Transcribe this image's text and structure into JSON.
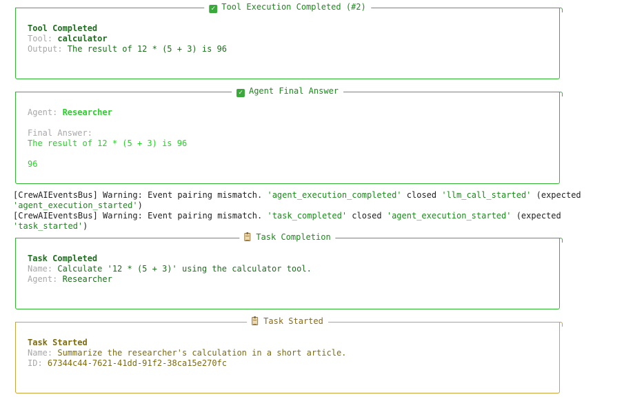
{
  "panels": {
    "tool": {
      "title": "Tool Execution Completed (#2)",
      "heading": "Tool Completed",
      "tool_label": "Tool: ",
      "tool_value": "calculator",
      "output_label": "Output: ",
      "output_value": "The result of 12 * (5 + 3) is 96",
      "color": "#2fb52f"
    },
    "answer": {
      "title": "Agent Final Answer",
      "agent_label": "Agent: ",
      "agent_value": "Researcher",
      "final_label": "Final Answer:",
      "final_line1": "The result of 12 * (5 + 3) is 96",
      "final_line2": "96",
      "color": "#2fb52f"
    },
    "task_completion": {
      "title": "Task Completion",
      "heading": "Task Completed",
      "name_label": "Name: ",
      "name_value": "Calculate '12 * (5 + 3)' using the calculator tool.",
      "agent_label": "Agent: ",
      "agent_value": "Researcher",
      "color": "#2fb52f"
    },
    "task_started": {
      "title": "Task Started",
      "heading": "Task Started",
      "name_label": "Name: ",
      "name_value": "Summarize the researcher's calculation in a short article.",
      "id_label": "ID: ",
      "id_value": "67344c44-7621-41dd-91f2-38ca15e270fc",
      "color": "#c8a23a"
    }
  },
  "warnings": [
    {
      "prefix": "[CrewAIEventsBus] Warning: Event pairing mismatch. ",
      "closed_event": "'agent_execution_completed'",
      "mid": " closed ",
      "open_event": "'llm_call_started'",
      "tail": " (expected",
      "expected": "'agent_execution_started'",
      "end": ")"
    },
    {
      "prefix": "[CrewAIEventsBus] Warning: Event pairing mismatch. ",
      "closed_event": "'task_completed'",
      "mid": " closed ",
      "open_event": "'agent_execution_started'",
      "tail": " (expected",
      "expected": "'task_started'",
      "end": ")"
    }
  ],
  "icons": {
    "check": "check-mark-icon",
    "clipboard": "clipboard-icon"
  }
}
